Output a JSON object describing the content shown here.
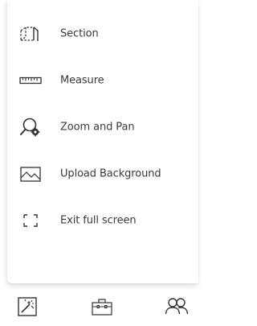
{
  "menu": {
    "items": [
      {
        "label": "Section",
        "icon": "section-icon"
      },
      {
        "label": "Measure",
        "icon": "ruler-icon"
      },
      {
        "label": "Zoom and Pan",
        "icon": "zoom-pan-icon"
      },
      {
        "label": "Upload Background",
        "icon": "image-icon"
      },
      {
        "label": "Exit full screen",
        "icon": "exit-fullscreen-icon"
      }
    ]
  },
  "bottom_bar": {
    "buttons": [
      {
        "icon": "magic-wand-icon"
      },
      {
        "icon": "toolbox-icon"
      },
      {
        "icon": "people-icon"
      }
    ]
  },
  "colors": {
    "text": "#3a3a3a",
    "icon": "#333333"
  }
}
